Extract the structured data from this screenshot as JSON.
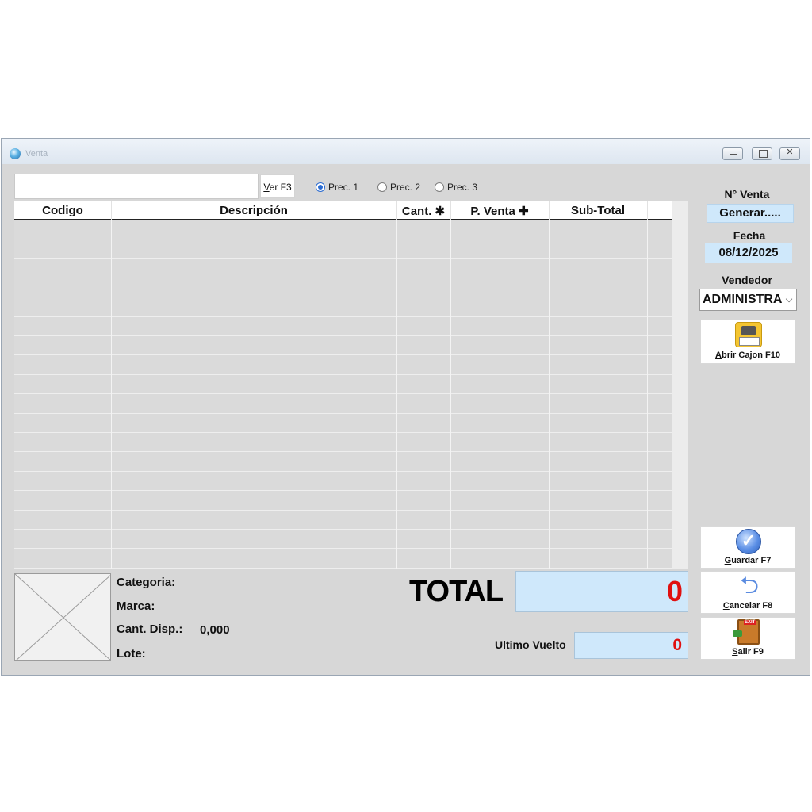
{
  "window": {
    "title": "Venta"
  },
  "toolbar": {
    "search_value": "",
    "search_placeholder": "",
    "ver_label": "Ver F3",
    "ver_label_underline": "V",
    "ver_label_rest": "er F3"
  },
  "price_options": [
    {
      "label": "Prec. 1",
      "selected": true
    },
    {
      "label": "Prec. 2",
      "selected": false
    },
    {
      "label": "Prec. 3",
      "selected": false
    }
  ],
  "grid": {
    "columns": [
      {
        "label": "Codigo"
      },
      {
        "label": "Descripción"
      },
      {
        "label": "Cant."
      },
      {
        "label": "P. Venta"
      },
      {
        "label": "Sub-Total"
      }
    ],
    "rows": []
  },
  "sidebar": {
    "nventa_label": "N° Venta",
    "nventa_value": "Generar.....",
    "fecha_label": "Fecha",
    "fecha_value": "08/12/2025",
    "vendedor_label": "Vendedor",
    "vendedor_value": "ADMINISTRA",
    "abrir": {
      "underline": "A",
      "rest": "brir Cajon F10",
      "icon": "cash-register-icon"
    },
    "guardar": {
      "underline": "G",
      "rest": "uardar F7",
      "icon": "check-icon"
    },
    "cancelar": {
      "underline": "C",
      "rest": "ancelar F8",
      "icon": "back-arrow-icon"
    },
    "salir": {
      "underline": "S",
      "rest": "alir F9",
      "icon": "exit-door-icon"
    }
  },
  "product_info": {
    "categoria_label": "Categoria:",
    "categoria_value": "",
    "marca_label": "Marca:",
    "marca_value": "",
    "cant_label": "Cant. Disp.:",
    "cant_value": "0,000",
    "lote_label": "Lote:",
    "lote_value": ""
  },
  "totals": {
    "total_label": "TOTAL",
    "total_value": "0",
    "vuelto_label": "Ultimo Vuelto",
    "vuelto_value": "0"
  },
  "colors": {
    "window_bg": "#d7d7d7",
    "field_blue": "#cfe8fb",
    "total_red": "#e01010",
    "radio_accent": "#2a6bd1"
  }
}
